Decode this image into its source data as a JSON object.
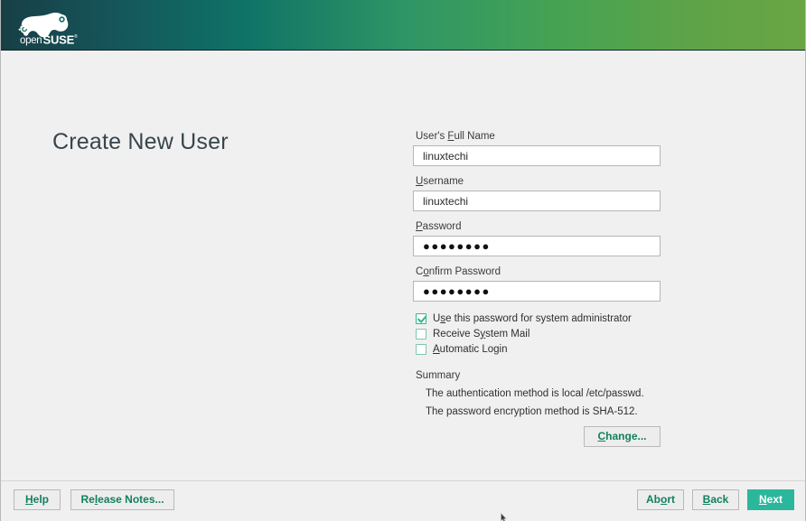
{
  "branding": {
    "logo_name": "opensuse-logo",
    "wordmark_light": "open",
    "wordmark_bold": "SUSE",
    "gradient_start": "#173f46",
    "gradient_end": "#6aa544"
  },
  "page": {
    "title": "Create New User"
  },
  "form": {
    "full_name": {
      "label_pre": "User's ",
      "label_accel": "F",
      "label_post": "ull Name",
      "value": "linuxtechi",
      "placeholder": ""
    },
    "username": {
      "label_pre": "",
      "label_accel": "U",
      "label_post": "sername",
      "value": "linuxtechi",
      "placeholder": ""
    },
    "password": {
      "label_pre": "",
      "label_accel": "P",
      "label_post": "assword",
      "value": "●●●●●●●●",
      "placeholder": ""
    },
    "confirm_password": {
      "label_pre": "C",
      "label_accel": "o",
      "label_post": "nfirm Password",
      "value": "●●●●●●●●",
      "placeholder": ""
    }
  },
  "checkboxes": [
    {
      "label_pre": "U",
      "label_accel": "s",
      "label_post": "e this password for system administrator",
      "checked": true
    },
    {
      "label_pre": "Receive S",
      "label_accel": "y",
      "label_post": "stem Mail",
      "checked": false
    },
    {
      "label_pre": "",
      "label_accel": "A",
      "label_post": "utomatic Login",
      "checked": false
    }
  ],
  "summary": {
    "title": "Summary",
    "lines": [
      "The authentication method is local /etc/passwd.",
      "The password encryption method is SHA-512."
    ],
    "change_button": {
      "label_pre": "",
      "label_accel": "C",
      "label_post": "hange..."
    }
  },
  "bottom_bar": {
    "help": {
      "label_pre": "",
      "label_accel": "H",
      "label_post": "elp"
    },
    "release_notes": {
      "label_pre": "Re",
      "label_accel": "l",
      "label_post": "ease Notes..."
    },
    "abort": {
      "label_pre": "Ab",
      "label_accel": "o",
      "label_post": "rt"
    },
    "back": {
      "label_pre": "",
      "label_accel": "B",
      "label_post": "ack"
    },
    "next": {
      "label_pre": "",
      "label_accel": "N",
      "label_post": "ext"
    }
  },
  "colors": {
    "accent_green": "#12805f",
    "next_button": "#2bb79b",
    "body_bg": "#f0f0f0",
    "title_text": "#38454d"
  }
}
